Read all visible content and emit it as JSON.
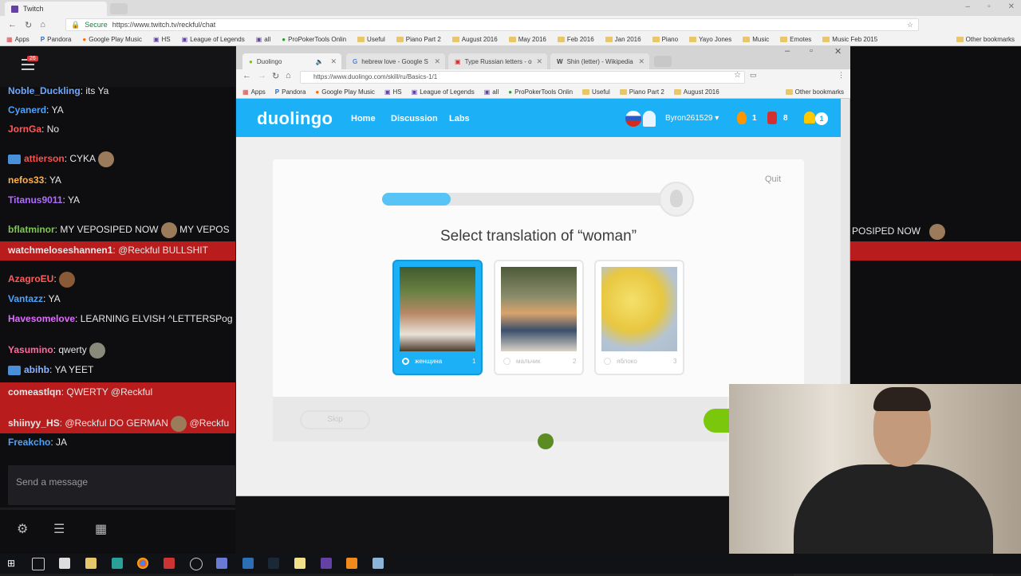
{
  "outer": {
    "tab_title": "Twitch",
    "url_secure": "Secure",
    "url": "https://www.twitch.tv/reckful/chat",
    "bookmarks": [
      "Apps",
      "Pandora",
      "Google Play Music",
      "HS",
      "League of Legends",
      "all",
      "ProPokerTools Onlin",
      "Useful",
      "Piano Part 2",
      "August 2016",
      "May 2016",
      "Feb 2016",
      "Jan 2016",
      "Piano",
      "Yayo Jones",
      "Music",
      "Emotes",
      "Music Feb 2015"
    ],
    "other_bookmarks": "Other bookmarks"
  },
  "chat": {
    "notification_count": "26",
    "messages": [
      {
        "user": "Noble_Duckling",
        "text": "its Ya",
        "color": "#6ea8ff"
      },
      {
        "user": "Cyanerd",
        "text": "YA",
        "color": "#4aa3ff"
      },
      {
        "user": "JornGa",
        "text": "No",
        "color": "#ff5a5a"
      },
      {
        "user": "attierson",
        "text": "CYKA",
        "color": "#ff4f4f"
      },
      {
        "user": "nefos33",
        "text": "YA",
        "color": "#ffb347"
      },
      {
        "user": "Titanus9011",
        "text": "YA",
        "color": "#b06bff"
      },
      {
        "user": "bflatminor",
        "text": "MY VEPOSIPED NOW",
        "tail": "MY VEPOS",
        "color": "#7ec850"
      },
      {
        "user": "watchmeloseshannen1",
        "text": "@Reckful BULLSHIT",
        "color": "#ffffff"
      },
      {
        "user": "AzagroEU",
        "text": "",
        "color": "#ff5a5a"
      },
      {
        "user": "Vantazz",
        "text": "YA",
        "color": "#4aa3ff"
      },
      {
        "user": "Havesomelove",
        "text": "LEARNING ELVISH ^LETTERSPog",
        "color": "#e06bff"
      },
      {
        "user": "Yasumino",
        "text": "qwerty",
        "color": "#ff6b9b"
      },
      {
        "user": "abihb",
        "text": "YA YEET",
        "color": "#8ab4ff"
      },
      {
        "user": "comeastlqn",
        "text": "QWERTY @Reckful",
        "color": "#ffffff"
      },
      {
        "user": "shiinyy_HS",
        "text": "@Reckful DO GERMAN",
        "tail": "@Reckfu",
        "color": "#ffffff"
      },
      {
        "user": "Freakcho",
        "text": "JA",
        "color": "#4aa3ff"
      }
    ],
    "input_placeholder": "Send a message"
  },
  "right_chat": {
    "line": "POSIPED NOW"
  },
  "inner": {
    "tabs": [
      {
        "title": "Duolingo"
      },
      {
        "title": "hebrew love - Google S"
      },
      {
        "title": "Type Russian letters - o"
      },
      {
        "title": "Shin (letter) - Wikipedia"
      }
    ],
    "url": "https://www.duolingo.com/skill/ru/Basics-1/1",
    "bookmarks": [
      "Apps",
      "Pandora",
      "Google Play Music",
      "HS",
      "League of Legends",
      "all",
      "ProPokerTools Onlin",
      "Useful",
      "Piano Part 2",
      "August 2016"
    ],
    "other_bookmarks": "Other bookmarks"
  },
  "duolingo": {
    "logo": "duolingo",
    "nav": [
      "Home",
      "Discussion",
      "Labs"
    ],
    "username": "Byron261529",
    "streak": "1",
    "lingots": "8",
    "notifications": "1",
    "quit": "Quit",
    "progress": 0.24,
    "question": "Select translation of “woman”",
    "options": [
      {
        "label": "женщина",
        "num": "1"
      },
      {
        "label": "мальчик",
        "num": "2"
      },
      {
        "label": "яблоко",
        "num": "3"
      }
    ],
    "skip": "Skip"
  }
}
